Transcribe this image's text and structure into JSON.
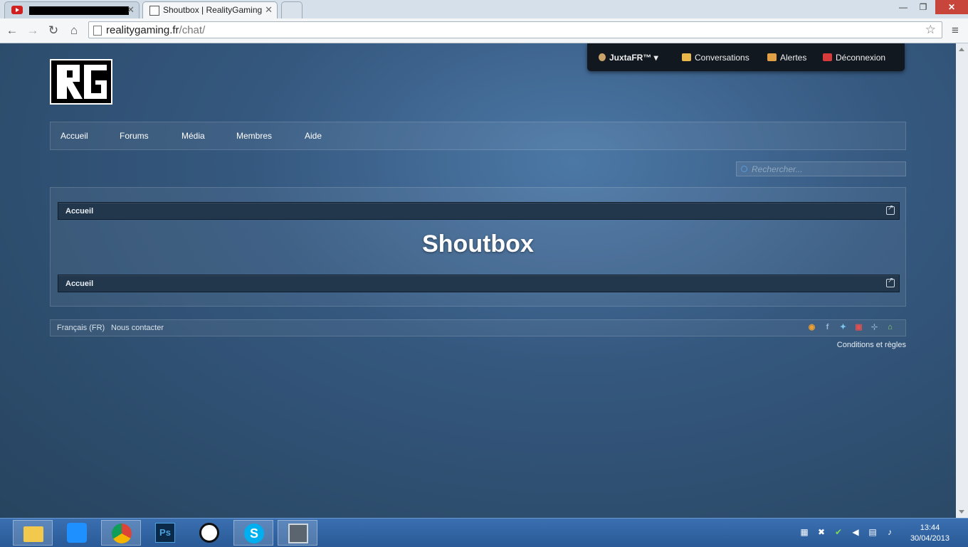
{
  "browser": {
    "tabs": [
      {
        "title": "",
        "favicon": "youtube-icon"
      },
      {
        "title": "Shoutbox | RealityGaming",
        "favicon": "realitygaming-icon",
        "active": true
      }
    ],
    "url": {
      "host": "realitygaming.fr",
      "path": "/chat/"
    }
  },
  "site": {
    "userbar": {
      "username": "JuxtaFR™",
      "conversations": "Conversations",
      "alerts": "Alertes",
      "logout": "Déconnexion"
    },
    "nav": [
      "Accueil",
      "Forums",
      "Média",
      "Membres",
      "Aide"
    ],
    "search": {
      "placeholder": "Rechercher..."
    },
    "breadcrumb": "Accueil",
    "page_title": "Shoutbox",
    "footer": {
      "language": "Français (FR)",
      "contact": "Nous contacter",
      "legal": "Conditions et règles",
      "social_icons": [
        "rss-icon",
        "facebook-icon",
        "twitter-icon",
        "youtube-icon",
        "sitemap-icon",
        "home-icon"
      ]
    }
  },
  "taskbar": {
    "apps": [
      "file-explorer-icon",
      "media-player-icon",
      "chrome-icon",
      "photoshop-icon",
      "app-icon",
      "skype-icon",
      "monitor-icon"
    ],
    "clock": {
      "time": "13:44",
      "date": "30/04/2013"
    }
  }
}
